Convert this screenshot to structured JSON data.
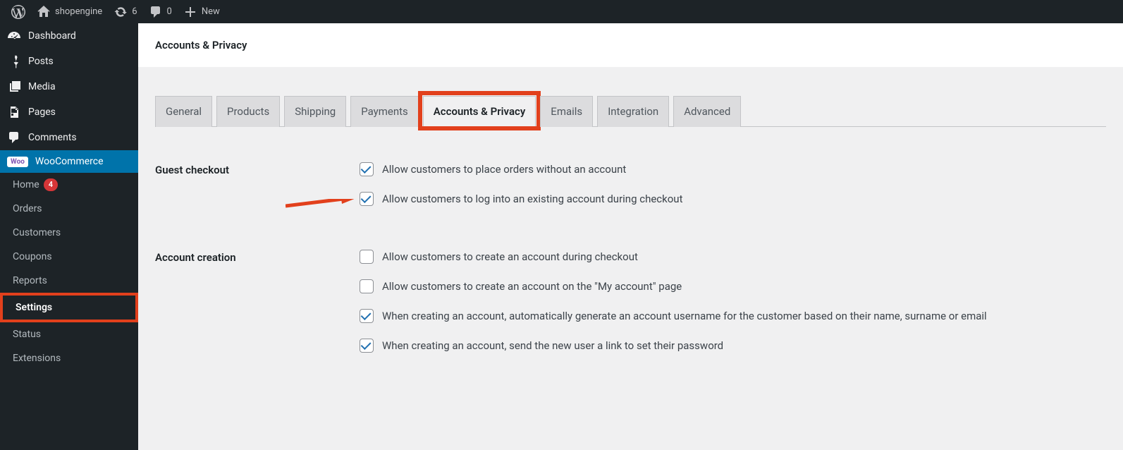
{
  "adminbar": {
    "site_name": "shopengine",
    "updates_count": "6",
    "comments_count": "0",
    "new_label": "New"
  },
  "sidebar": {
    "dashboard": "Dashboard",
    "posts": "Posts",
    "media": "Media",
    "pages": "Pages",
    "comments": "Comments",
    "woocommerce": "WooCommerce",
    "woo_badge": "Woo",
    "sub": {
      "home": "Home",
      "home_badge": "4",
      "orders": "Orders",
      "customers": "Customers",
      "coupons": "Coupons",
      "reports": "Reports",
      "settings": "Settings",
      "status": "Status",
      "extensions": "Extensions"
    }
  },
  "header": {
    "title": "Accounts & Privacy"
  },
  "tabs": {
    "general": "General",
    "products": "Products",
    "shipping": "Shipping",
    "payments": "Payments",
    "accounts": "Accounts & Privacy",
    "emails": "Emails",
    "integration": "Integration",
    "advanced": "Advanced"
  },
  "sections": {
    "guest_checkout": {
      "label": "Guest checkout",
      "opt1": {
        "checked": true,
        "text": "Allow customers to place orders without an account"
      },
      "opt2": {
        "checked": true,
        "text": "Allow customers to log into an existing account during checkout"
      }
    },
    "account_creation": {
      "label": "Account creation",
      "opt1": {
        "checked": false,
        "text": "Allow customers to create an account during checkout"
      },
      "opt2": {
        "checked": false,
        "text": "Allow customers to create an account on the \"My account\" page"
      },
      "opt3": {
        "checked": true,
        "text": "When creating an account, automatically generate an account username for the customer based on their name, surname or email"
      },
      "opt4": {
        "checked": true,
        "text": "When creating an account, send the new user a link to set their password"
      }
    }
  }
}
